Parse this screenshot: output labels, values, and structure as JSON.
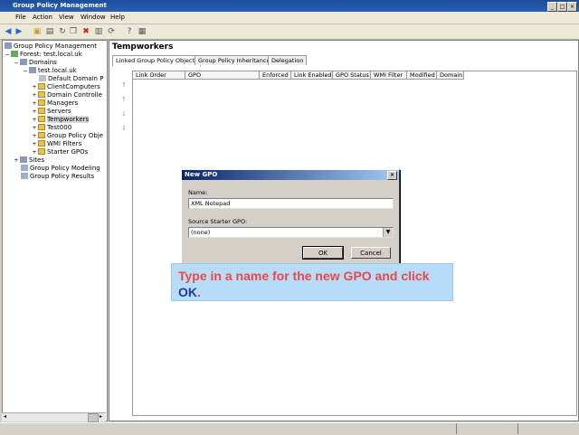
{
  "window": {
    "title": "Group Policy Management",
    "btn_min": "_",
    "btn_max": "□",
    "btn_close": "×"
  },
  "menu": [
    "File",
    "Action",
    "View",
    "Window",
    "Help"
  ],
  "toolbar_icons": [
    "back-icon",
    "forward-icon",
    "up-folder-icon",
    "properties-icon",
    "refresh-icon",
    "copy-icon",
    "delete-icon",
    "export-icon",
    "help-icon",
    "console-icon"
  ],
  "tree": {
    "items": [
      {
        "label": "Group Policy Management"
      },
      {
        "label": "Forest: test.local.uk"
      },
      {
        "label": "Domains"
      },
      {
        "label": "test.local.uk"
      },
      {
        "label": "Default Domain P"
      },
      {
        "label": "ClientComputers"
      },
      {
        "label": "Domain Controlle"
      },
      {
        "label": "Managers"
      },
      {
        "label": "Servers"
      },
      {
        "label": "Tempworkers"
      },
      {
        "label": "Test000"
      },
      {
        "label": "Group Policy Obje"
      },
      {
        "label": "WMI Filters"
      },
      {
        "label": "Starter GPOs"
      },
      {
        "label": "Sites"
      },
      {
        "label": "Group Policy Modeling"
      },
      {
        "label": "Group Policy Results"
      }
    ]
  },
  "main": {
    "heading": "Tempworkers",
    "tabs": [
      "Linked Group Policy Objects",
      "Group Policy Inheritance",
      "Delegation"
    ],
    "columns": [
      "Link Order",
      "GPO",
      "Enforced",
      "Link Enabled",
      "GPO Status",
      "WMI Filter",
      "Modified",
      "Domain"
    ]
  },
  "dialog": {
    "title": "New GPO",
    "name_label": "Name:",
    "name_value": "XML Notepad",
    "source_label": "Source Starter GPO:",
    "source_value": "(none)",
    "ok": "OK",
    "cancel": "Cancel",
    "close": "×"
  },
  "callout": {
    "text_before": "Type in a name for the new GPO and click ",
    "highlight": "OK",
    "text_after": "."
  }
}
